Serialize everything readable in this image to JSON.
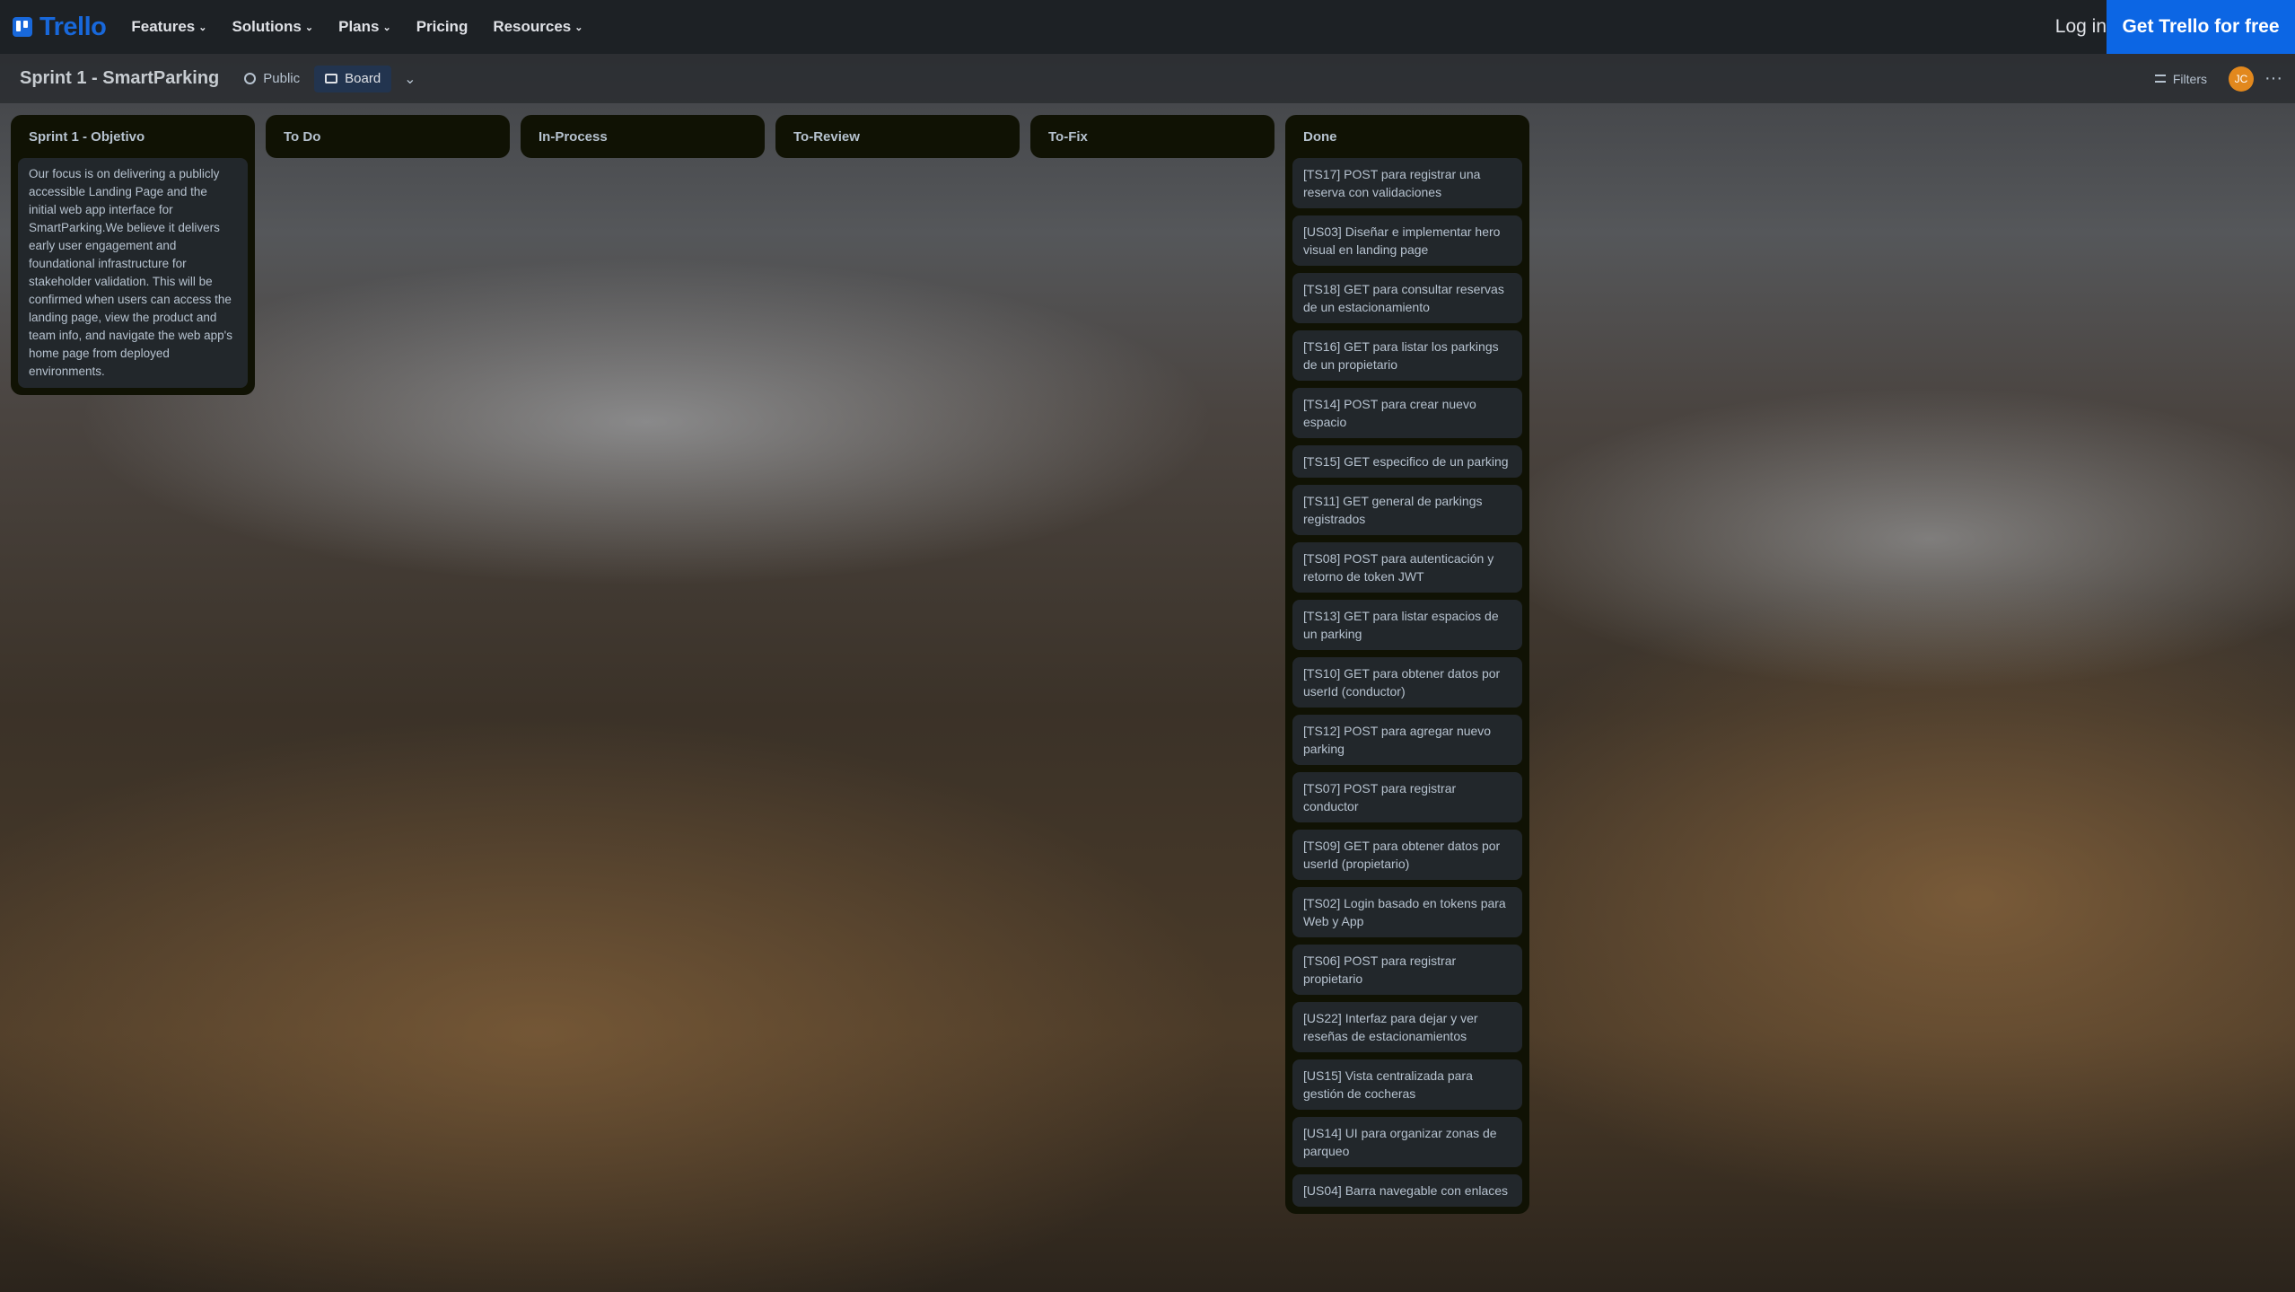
{
  "nav": {
    "logo": "Trello",
    "items": [
      {
        "label": "Features",
        "has_menu": true
      },
      {
        "label": "Solutions",
        "has_menu": true
      },
      {
        "label": "Plans",
        "has_menu": true
      },
      {
        "label": "Pricing",
        "has_menu": false
      },
      {
        "label": "Resources",
        "has_menu": true
      }
    ],
    "login": "Log in",
    "cta": "Get Trello for free"
  },
  "board": {
    "title": "Sprint 1 - SmartParking",
    "visibility": "Public",
    "view": "Board",
    "filters": "Filters",
    "avatar_initials": "JC"
  },
  "lists": [
    {
      "title": "Sprint 1 - Objetivo",
      "cards": [
        "Our focus is on delivering a publicly accessible Landing Page and the initial web app interface for SmartParking.We believe it delivers early user engagement and foundational infrastructure for stakeholder validation. This will be confirmed when users can access the landing page, view the product and team info, and navigate the web app's home page from deployed environments."
      ]
    },
    {
      "title": "To Do",
      "cards": []
    },
    {
      "title": "In-Process",
      "cards": []
    },
    {
      "title": "To-Review",
      "cards": []
    },
    {
      "title": "To-Fix",
      "cards": []
    },
    {
      "title": "Done",
      "cards": [
        "[TS17] POST para registrar una reserva con validaciones",
        "[US03] Diseñar e implementar hero visual en landing page",
        "[TS18] GET para consultar reservas de un estacionamiento",
        "[TS16] GET para listar los parkings de un propietario",
        "[TS14] POST para crear nuevo espacio",
        "[TS15] GET especifico de un parking",
        "[TS11] GET general de parkings registrados",
        "[TS08] POST para autenticación y retorno de token JWT",
        "[TS13] GET para listar espacios de un parking",
        "[TS10] GET para obtener datos por userId (conductor)",
        "[TS12] POST para agregar nuevo parking",
        "[TS07] POST para registrar conductor",
        "[TS09] GET para obtener datos por userId (propietario)",
        "[TS02] Login basado en tokens para Web y App",
        "[TS06] POST para registrar propietario",
        "[US22] Interfaz para dejar y ver reseñas de estacionamientos",
        "[US15] Vista centralizada para gestión de cocheras",
        "[US14] UI para organizar zonas de parqueo",
        "[US04] Barra navegable con enlaces"
      ]
    }
  ]
}
